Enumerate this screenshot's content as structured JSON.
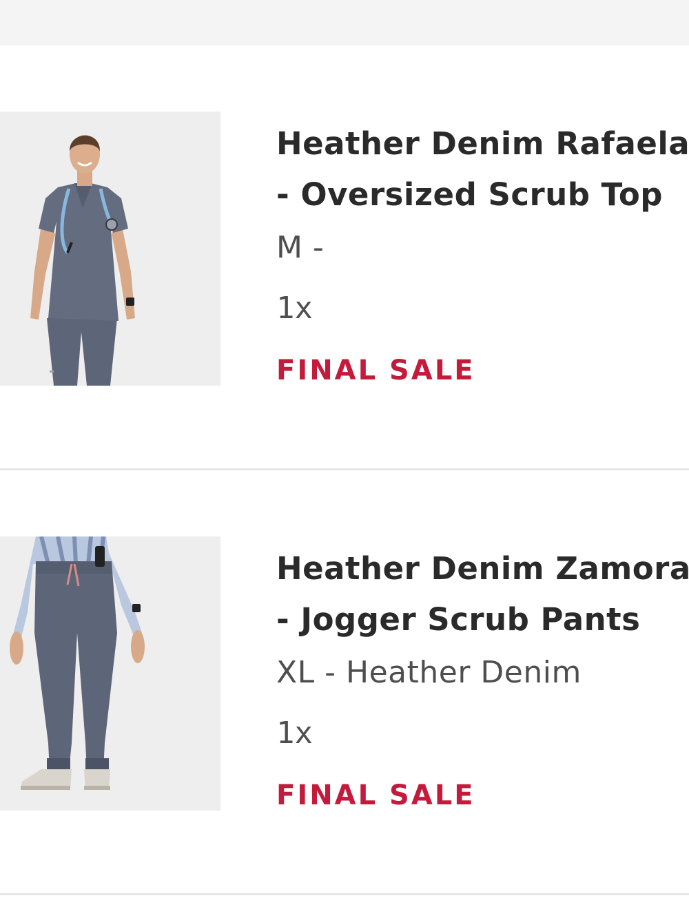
{
  "cart": {
    "items": [
      {
        "title_line1": "Heather Denim Rafaela",
        "title_line2": "- Oversized Scrub Top",
        "variant": "M -",
        "quantity": "1x",
        "badge": "FINAL SALE",
        "image_icon": "scrub-top-photo"
      },
      {
        "title_line1": "Heather Denim Zamora",
        "title_line2": "- Jogger Scrub Pants",
        "variant": "XL - Heather Denim",
        "quantity": "1x",
        "badge": "FINAL SALE",
        "image_icon": "jogger-pants-photo"
      }
    ]
  },
  "colors": {
    "sale": "#c41a3b",
    "title": "#2a2a2a",
    "muted": "#4e4e4e",
    "denim": "#5d6578"
  }
}
